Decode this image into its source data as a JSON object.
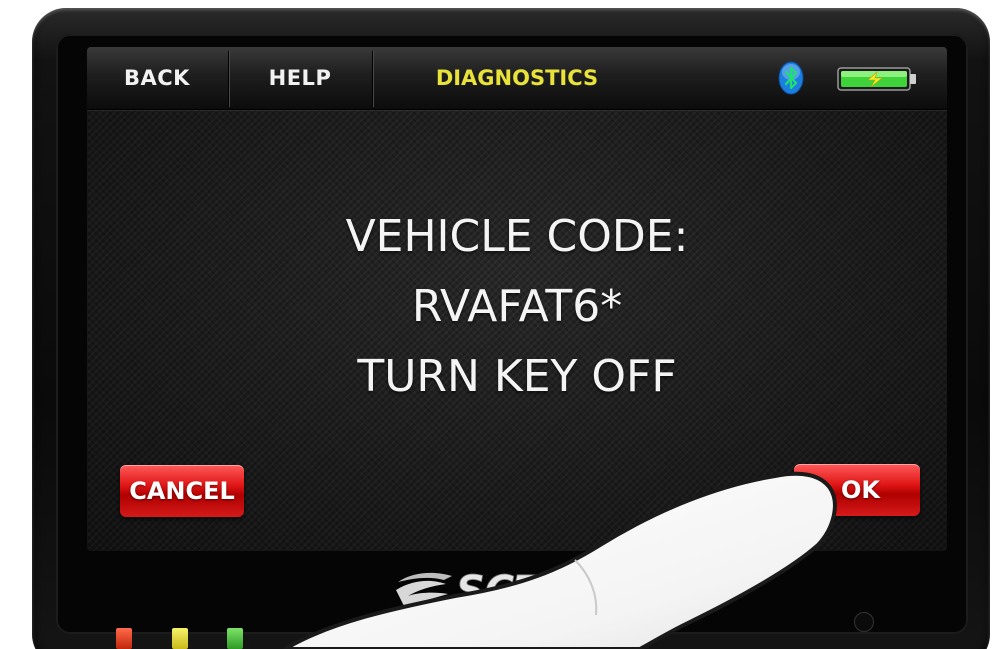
{
  "topbar": {
    "back_label": "BACK",
    "help_label": "HELP",
    "title": "DIAGNOSTICS",
    "bluetooth_icon": "bluetooth-icon",
    "battery_icon": "battery-charging-icon"
  },
  "message": {
    "line1": "VEHICLE CODE:",
    "line2": "RVAFAT6*",
    "line3": "TURN KEY OFF"
  },
  "buttons": {
    "cancel_label": "CANCEL",
    "ok_label": "OK"
  },
  "brand": {
    "logo_text": "SCT"
  },
  "status_leds": [
    "red",
    "yellow",
    "green"
  ],
  "colors": {
    "title_yellow": "#e8e23a",
    "button_red": "#d51a1a",
    "bluetooth_blue": "#1c7fe0",
    "battery_green": "#3fd23a"
  }
}
